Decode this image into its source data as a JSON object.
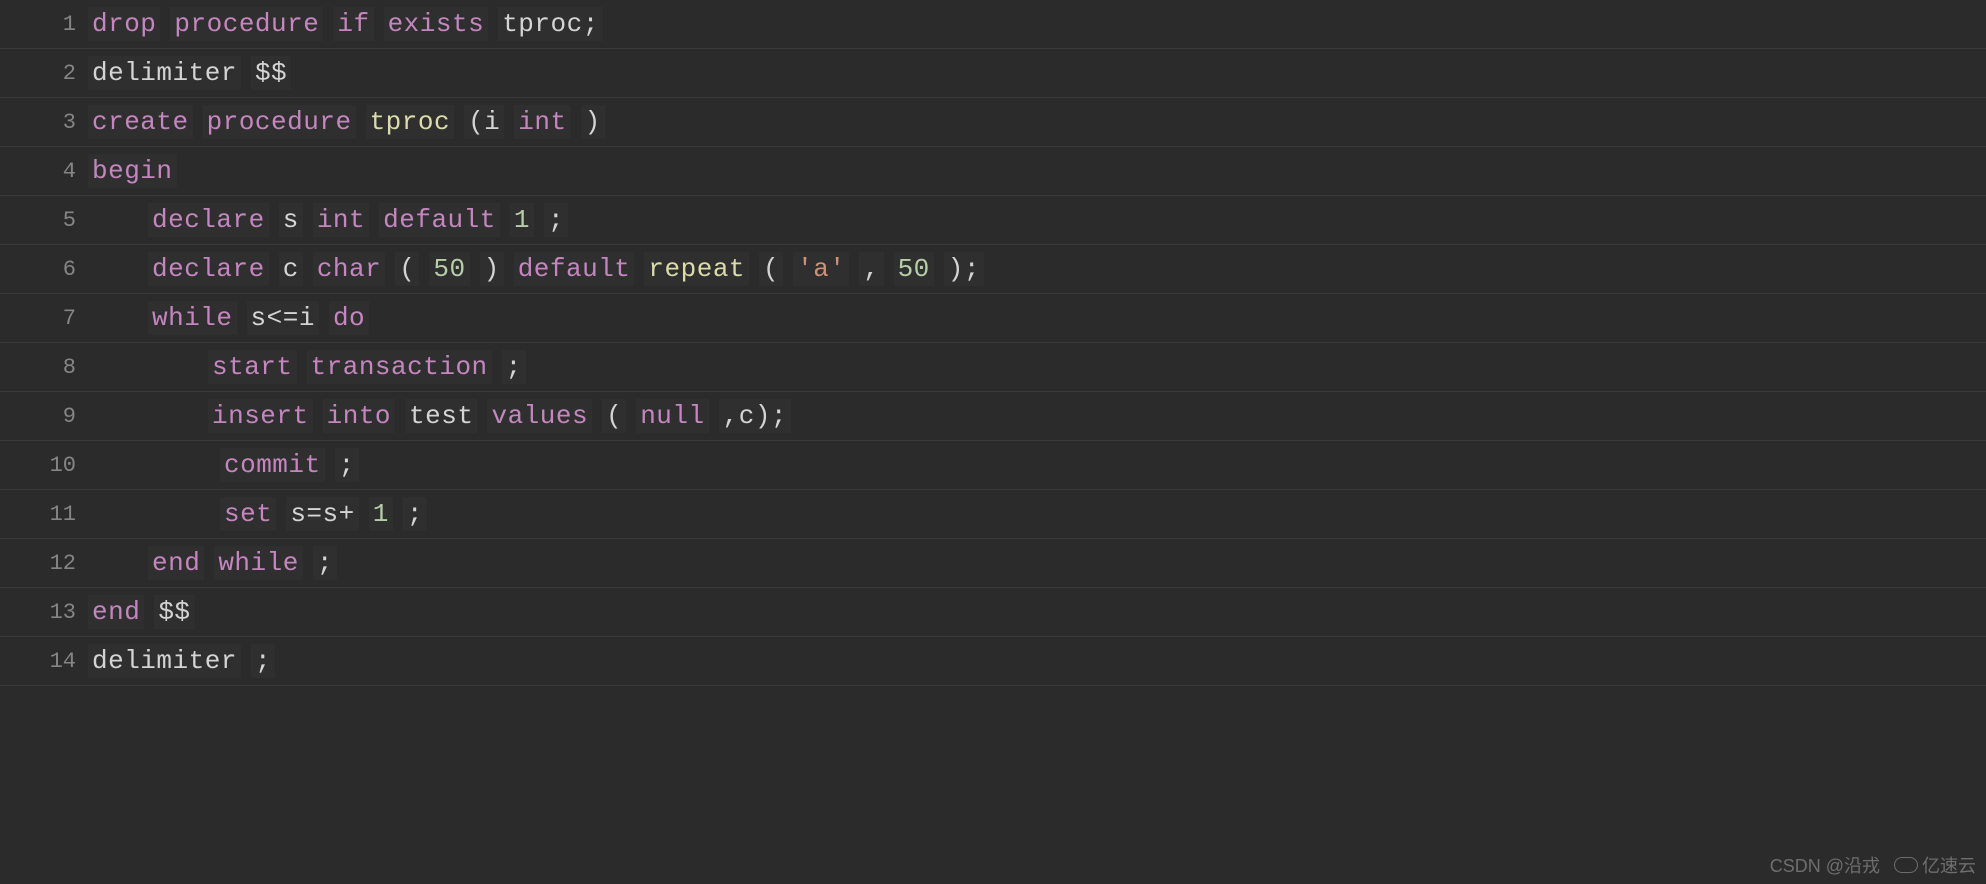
{
  "lines": [
    {
      "num": "1",
      "indent": "",
      "tokens": [
        {
          "cls": "kw-purple",
          "t": "drop"
        },
        {
          "cls": "kw-purple",
          "t": "procedure"
        },
        {
          "cls": "kw-purple",
          "t": "if"
        },
        {
          "cls": "kw-purple",
          "t": "exists"
        },
        {
          "cls": "txt",
          "t": "tproc;"
        }
      ]
    },
    {
      "num": "2",
      "indent": "",
      "tokens": [
        {
          "cls": "txt",
          "t": "delimiter"
        },
        {
          "cls": "txt",
          "t": "$$"
        }
      ]
    },
    {
      "num": "3",
      "indent": "",
      "tokens": [
        {
          "cls": "kw-purple",
          "t": "create"
        },
        {
          "cls": "kw-purple",
          "t": "procedure"
        },
        {
          "cls": "fn-yellow",
          "t": "tproc"
        },
        {
          "cls": "paren",
          "t": "(i"
        },
        {
          "cls": "kw-purple",
          "t": "int"
        },
        {
          "cls": "paren",
          "t": ")"
        }
      ]
    },
    {
      "num": "4",
      "indent": "",
      "tokens": [
        {
          "cls": "kw-purple",
          "t": "begin"
        }
      ]
    },
    {
      "num": "5",
      "indent": "indent1",
      "tokens": [
        {
          "cls": "kw-purple",
          "t": "declare"
        },
        {
          "cls": "txt",
          "t": "s"
        },
        {
          "cls": "kw-purple",
          "t": "int"
        },
        {
          "cls": "kw-purple",
          "t": "default"
        },
        {
          "cls": "num",
          "t": "1"
        },
        {
          "cls": "txt",
          "t": ";"
        }
      ]
    },
    {
      "num": "6",
      "indent": "indent1",
      "tokens": [
        {
          "cls": "kw-purple",
          "t": "declare"
        },
        {
          "cls": "txt",
          "t": "c"
        },
        {
          "cls": "kw-purple",
          "t": "char"
        },
        {
          "cls": "paren",
          "t": "("
        },
        {
          "cls": "num",
          "t": "50"
        },
        {
          "cls": "paren",
          "t": ")"
        },
        {
          "cls": "kw-purple",
          "t": "default"
        },
        {
          "cls": "fn-yellow",
          "t": "repeat"
        },
        {
          "cls": "paren",
          "t": "("
        },
        {
          "cls": "str",
          "t": "'a'"
        },
        {
          "cls": "txt",
          "t": ","
        },
        {
          "cls": "num",
          "t": "50"
        },
        {
          "cls": "paren",
          "t": ");"
        }
      ]
    },
    {
      "num": "7",
      "indent": "indent1",
      "tokens": [
        {
          "cls": "kw-purple",
          "t": "while"
        },
        {
          "cls": "txt",
          "t": "s<=i"
        },
        {
          "cls": "kw-purple",
          "t": "do"
        }
      ]
    },
    {
      "num": "8",
      "indent": "indent2",
      "tokens": [
        {
          "cls": "kw-purple",
          "t": "start"
        },
        {
          "cls": "kw-purple",
          "t": "transaction"
        },
        {
          "cls": "txt",
          "t": ";"
        }
      ]
    },
    {
      "num": "9",
      "indent": "indent2",
      "tokens": [
        {
          "cls": "kw-purple",
          "t": "insert"
        },
        {
          "cls": "kw-purple",
          "t": "into"
        },
        {
          "cls": "txt",
          "t": "test"
        },
        {
          "cls": "kw-purple",
          "t": "values"
        },
        {
          "cls": "paren",
          "t": "("
        },
        {
          "cls": "kw-purple",
          "t": "null"
        },
        {
          "cls": "txt",
          "t": ",c);"
        }
      ]
    },
    {
      "num": "10",
      "indent": "indent3",
      "tokens": [
        {
          "cls": "kw-purple",
          "t": "commit"
        },
        {
          "cls": "txt",
          "t": ";"
        }
      ]
    },
    {
      "num": "11",
      "indent": "indent3",
      "tokens": [
        {
          "cls": "kw-purple",
          "t": "set"
        },
        {
          "cls": "txt",
          "t": "s=s+"
        },
        {
          "cls": "num",
          "t": "1"
        },
        {
          "cls": "txt",
          "t": ";"
        }
      ]
    },
    {
      "num": "12",
      "indent": "indent1",
      "tokens": [
        {
          "cls": "kw-purple",
          "t": "end"
        },
        {
          "cls": "kw-purple",
          "t": "while"
        },
        {
          "cls": "txt",
          "t": ";"
        }
      ]
    },
    {
      "num": "13",
      "indent": "",
      "tokens": [
        {
          "cls": "kw-purple",
          "t": "end"
        },
        {
          "cls": "txt",
          "t": "$$"
        }
      ]
    },
    {
      "num": "14",
      "indent": "",
      "tokens": [
        {
          "cls": "txt",
          "t": "delimiter"
        },
        {
          "cls": "txt",
          "t": ";"
        }
      ]
    }
  ],
  "watermark": {
    "csdn": "CSDN @沿戎",
    "yisu": "亿速云"
  }
}
